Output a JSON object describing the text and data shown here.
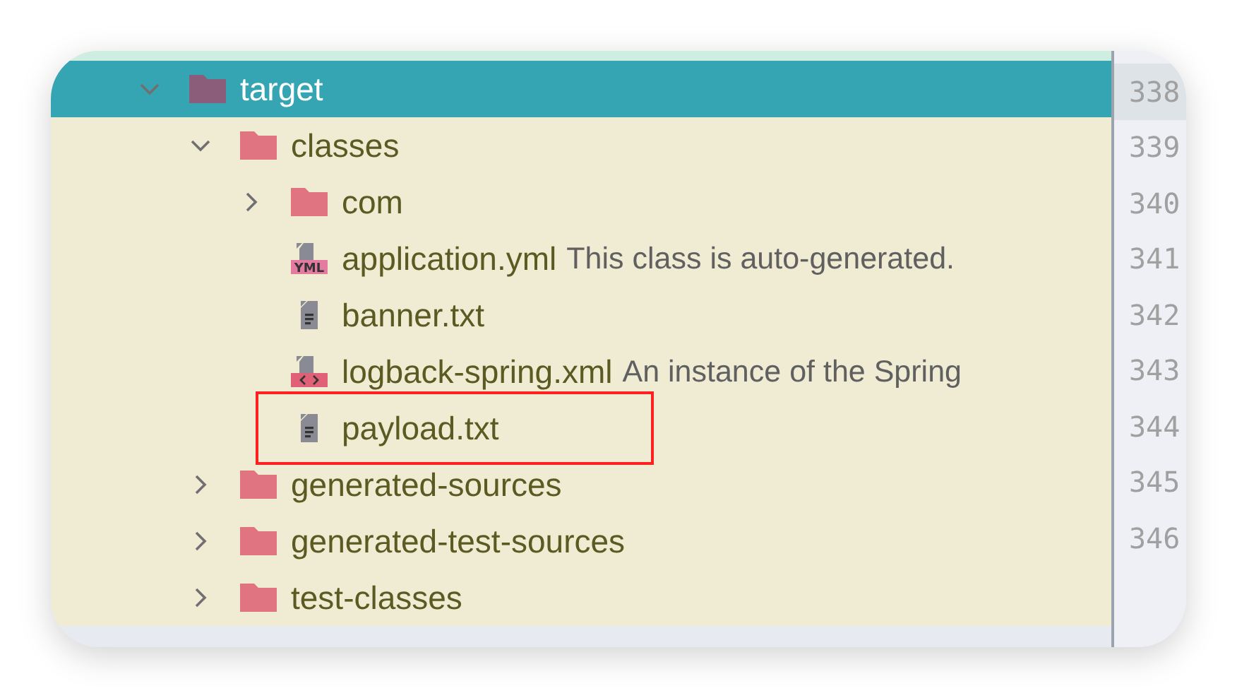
{
  "tree": [
    {
      "kind": "folder",
      "label": "target",
      "color": "#8c5d7a",
      "selected": true,
      "expanded": true,
      "children": [
        {
          "kind": "folder",
          "label": "classes",
          "color": "#e07480",
          "selected": false,
          "expanded": true,
          "children": [
            {
              "kind": "folder",
              "label": "com",
              "color": "#e07480",
              "selected": false,
              "expanded": false
            },
            {
              "kind": "yml",
              "badge": "YML",
              "label": "application.yml",
              "note": "This class is auto-generated.",
              "selected": false
            },
            {
              "kind": "txt",
              "label": "banner.txt",
              "selected": false
            },
            {
              "kind": "xml",
              "label": "logback-spring.xml",
              "note": "An instance of the Spring",
              "selected": false
            },
            {
              "kind": "txt",
              "label": "payload.txt",
              "selected": false,
              "highlighted": true
            }
          ]
        },
        {
          "kind": "folder",
          "label": "generated-sources",
          "color": "#e07480",
          "selected": false,
          "expanded": false
        },
        {
          "kind": "folder",
          "label": "generated-test-sources",
          "color": "#e07480",
          "selected": false,
          "expanded": false
        },
        {
          "kind": "folder",
          "label": "test-classes",
          "color": "#e07480",
          "selected": false,
          "expanded": false
        }
      ]
    }
  ],
  "gutter": {
    "lines": [
      {
        "number": "338",
        "selected": true
      },
      {
        "number": "339",
        "selected": false
      },
      {
        "number": "340",
        "selected": false
      },
      {
        "number": "341",
        "selected": false
      },
      {
        "number": "342",
        "selected": false
      },
      {
        "number": "343",
        "selected": false
      },
      {
        "number": "344",
        "selected": false
      },
      {
        "number": "345",
        "selected": false
      },
      {
        "number": "346",
        "selected": false
      }
    ]
  }
}
